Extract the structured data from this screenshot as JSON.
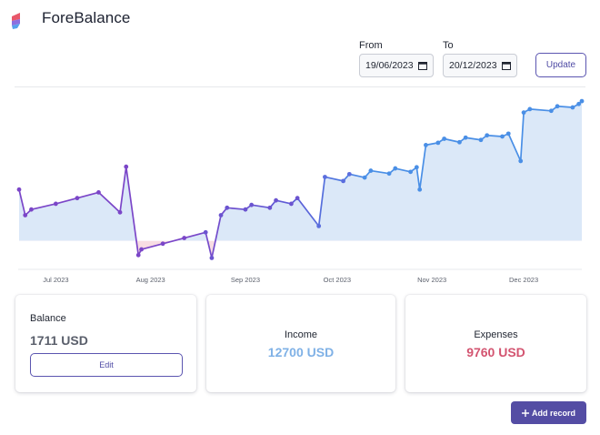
{
  "app": {
    "name": "ForeBalance"
  },
  "filters": {
    "from_label": "From",
    "to_label": "To",
    "from_value": "19/06/2023",
    "to_value": "20/12/2023",
    "update_label": "Update"
  },
  "chart_data": {
    "type": "area",
    "x_tick_labels": [
      "Jul 2023",
      "Aug 2023",
      "Sep 2023",
      "Oct 2023",
      "Nov 2023",
      "Dec 2023"
    ],
    "x_start": "2023-06-19",
    "x_end": "2023-12-20",
    "series": [
      {
        "values": [
          [
            "2023-06-19",
            900
          ],
          [
            "2023-06-21",
            450
          ],
          [
            "2023-06-23",
            550
          ],
          [
            "2023-07-01",
            650
          ],
          [
            "2023-07-08",
            750
          ],
          [
            "2023-07-15",
            850
          ],
          [
            "2023-07-22",
            500
          ],
          [
            "2023-07-24",
            1300
          ],
          [
            "2023-07-28",
            -250
          ],
          [
            "2023-07-29",
            -150
          ],
          [
            "2023-08-05",
            -50
          ],
          [
            "2023-08-12",
            50
          ],
          [
            "2023-08-19",
            150
          ],
          [
            "2023-08-21",
            -300
          ],
          [
            "2023-08-24",
            450
          ],
          [
            "2023-08-26",
            580
          ],
          [
            "2023-09-01",
            550
          ],
          [
            "2023-09-03",
            630
          ],
          [
            "2023-09-09",
            580
          ],
          [
            "2023-09-11",
            710
          ],
          [
            "2023-09-16",
            650
          ],
          [
            "2023-09-18",
            750
          ],
          [
            "2023-09-25",
            260
          ],
          [
            "2023-09-27",
            1120
          ],
          [
            "2023-10-03",
            1050
          ],
          [
            "2023-10-05",
            1170
          ],
          [
            "2023-10-10",
            1110
          ],
          [
            "2023-10-12",
            1230
          ],
          [
            "2023-10-18",
            1180
          ],
          [
            "2023-10-20",
            1270
          ],
          [
            "2023-10-25",
            1210
          ],
          [
            "2023-10-27",
            1290
          ],
          [
            "2023-10-28",
            900
          ],
          [
            "2023-10-30",
            1680
          ],
          [
            "2023-11-03",
            1720
          ],
          [
            "2023-11-05",
            1790
          ],
          [
            "2023-11-10",
            1730
          ],
          [
            "2023-11-12",
            1810
          ],
          [
            "2023-11-17",
            1770
          ],
          [
            "2023-11-19",
            1850
          ],
          [
            "2023-11-24",
            1830
          ],
          [
            "2023-11-26",
            1880
          ],
          [
            "2023-11-30",
            1400
          ],
          [
            "2023-12-01",
            2250
          ],
          [
            "2023-12-03",
            2310
          ],
          [
            "2023-12-10",
            2280
          ],
          [
            "2023-12-12",
            2360
          ],
          [
            "2023-12-17",
            2340
          ],
          [
            "2023-12-19",
            2400
          ],
          [
            "2023-12-20",
            2450
          ]
        ]
      }
    ],
    "ylim": [
      -500,
      2500
    ],
    "baseline": 0,
    "grid": false,
    "colors": {
      "purple": "#7b46c8",
      "blue": "#4a8fe6",
      "area_positive": "#dbe8f8",
      "area_negative": "#f8dde3"
    }
  },
  "cards": {
    "balance": {
      "title": "Balance",
      "value": "1711 USD",
      "edit_label": "Edit"
    },
    "income": {
      "title": "Income",
      "value": "12700 USD"
    },
    "expenses": {
      "title": "Expenses",
      "value": "9760 USD"
    }
  },
  "actions": {
    "add_record_label": "Add record"
  },
  "colors": {
    "accent": "#544da4",
    "income": "#7fb1e6",
    "expenses": "#d35470",
    "balance": "#5a5f6b"
  }
}
